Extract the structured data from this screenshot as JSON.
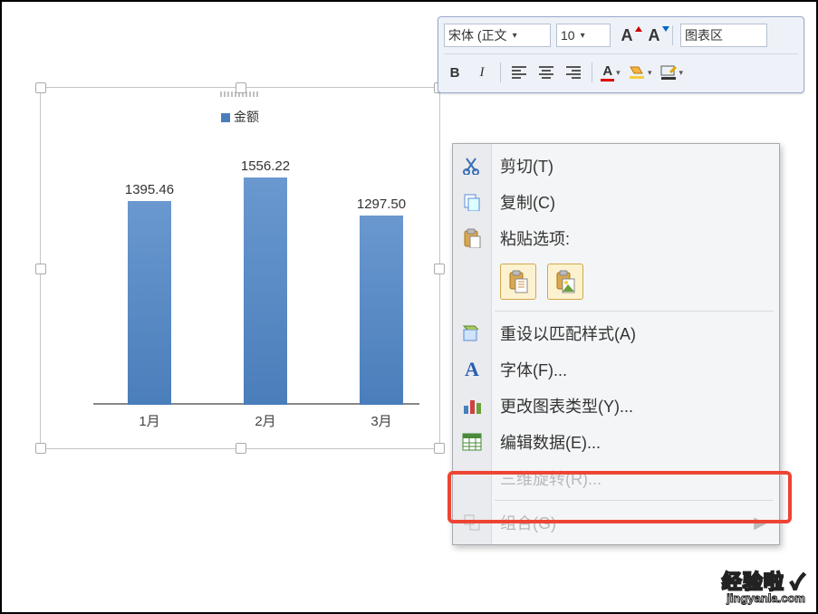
{
  "toolbar": {
    "font_name": "宋体 (正文",
    "font_size": "10",
    "area_label": "图表区",
    "bold": "B",
    "italic": "I"
  },
  "chart_data": {
    "type": "bar",
    "series_name": "金额",
    "categories": [
      "1月",
      "2月",
      "3月"
    ],
    "values": [
      1395.46,
      1556.22,
      1297.5
    ],
    "labels": [
      "1395.46",
      "1556.22",
      "1297.50"
    ],
    "ylim": [
      0,
      1800
    ],
    "title": "金额"
  },
  "menu": {
    "cut": "剪切(T)",
    "copy": "复制(C)",
    "paste_options": "粘贴选项:",
    "reset_style": "重设以匹配样式(A)",
    "font": "字体(F)...",
    "change_chart_type": "更改图表类型(Y)...",
    "edit_data": "编辑数据(E)...",
    "rotate_3d": "三维旋转(R)...",
    "group": "组合(G)"
  },
  "watermark": {
    "line1": "经验啦",
    "check": "✓",
    "line2": "jingyanla.com"
  }
}
